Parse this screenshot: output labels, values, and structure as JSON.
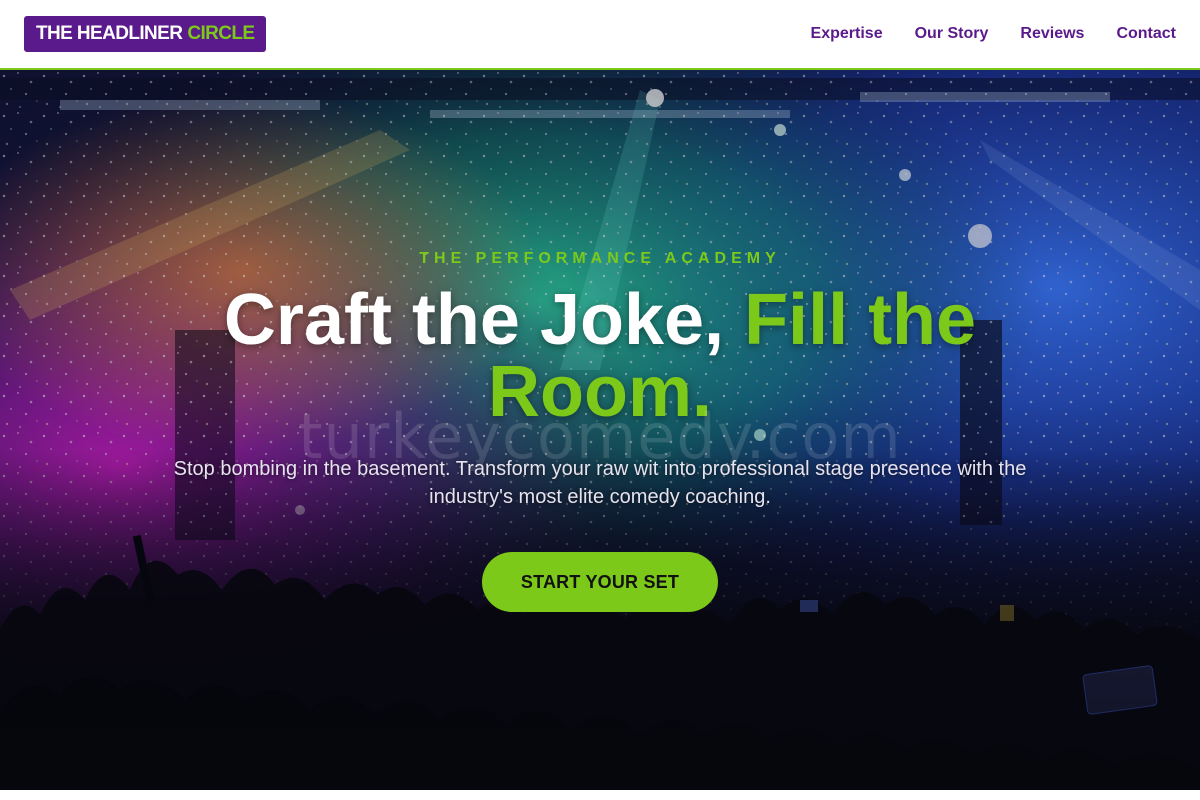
{
  "header": {
    "logo": {
      "part1": "THE HEADLINER",
      "part2": "CIRCLE"
    },
    "nav": [
      {
        "label": "Expertise"
      },
      {
        "label": "Our Story"
      },
      {
        "label": "Reviews"
      },
      {
        "label": "Contact"
      }
    ]
  },
  "hero": {
    "eyebrow": "THE PERFORMANCE ACADEMY",
    "headline_part1": "Craft the Joke,",
    "headline_part2": "Fill the Room.",
    "watermark": "turkeycomedy.com",
    "subtext": "Stop bombing in the basement. Transform your raw wit into professional stage presence with the industry's most elite comedy coaching.",
    "cta_label": "START YOUR SET",
    "background": "concert-crowd-photo"
  },
  "colors": {
    "brand_purple": "#5b1a8c",
    "accent_green": "#7cc91a",
    "white": "#ffffff"
  }
}
